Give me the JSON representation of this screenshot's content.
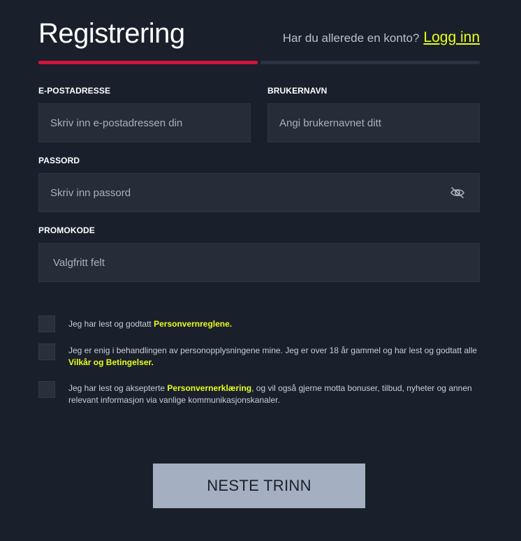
{
  "header": {
    "title": "Registrering",
    "have_account": "Har du allerede en konto?",
    "login_link": "Logg inn",
    "progress_fraction": 0.5
  },
  "form": {
    "email": {
      "label": "E-POSTADRESSE",
      "placeholder": "Skriv inn e-postadressen din",
      "value": ""
    },
    "username": {
      "label": "BRUKERNAVN",
      "placeholder": "Angi brukernavnet ditt",
      "value": ""
    },
    "password": {
      "label": "PASSORD",
      "placeholder": "Skriv inn passord",
      "value": "",
      "toggle_icon": "eye-slash-icon"
    },
    "promo": {
      "label": "PROMOKODE",
      "placeholder": "Valgfritt felt",
      "value": ""
    }
  },
  "consents": [
    {
      "text_before": "Jeg har lest og godtatt ",
      "link": "Personvernreglene.",
      "text_after": "",
      "checked": false
    },
    {
      "text_before": "Jeg er enig i behandlingen av personopplysningene mine. Jeg er over 18 år gammel og har lest og godtatt alle ",
      "link": "Vilkår og Betingelser.",
      "text_after": "",
      "checked": false
    },
    {
      "text_before": "Jeg har lest og aksepterte ",
      "link": "Personvernerklæring",
      "text_after": ", og vil også gjerne motta bonuser, tilbud, nyheter og annen relevant informasjon via vanlige kommunikasjonskanaler.",
      "checked": false
    }
  ],
  "next_button": "NESTE TRINN",
  "colors": {
    "background": "#1a202b",
    "accent_red": "#d3133a",
    "link_yellow": "#e8ff1a",
    "field_bg": "#252d39",
    "button_bg": "#a4afc1"
  }
}
